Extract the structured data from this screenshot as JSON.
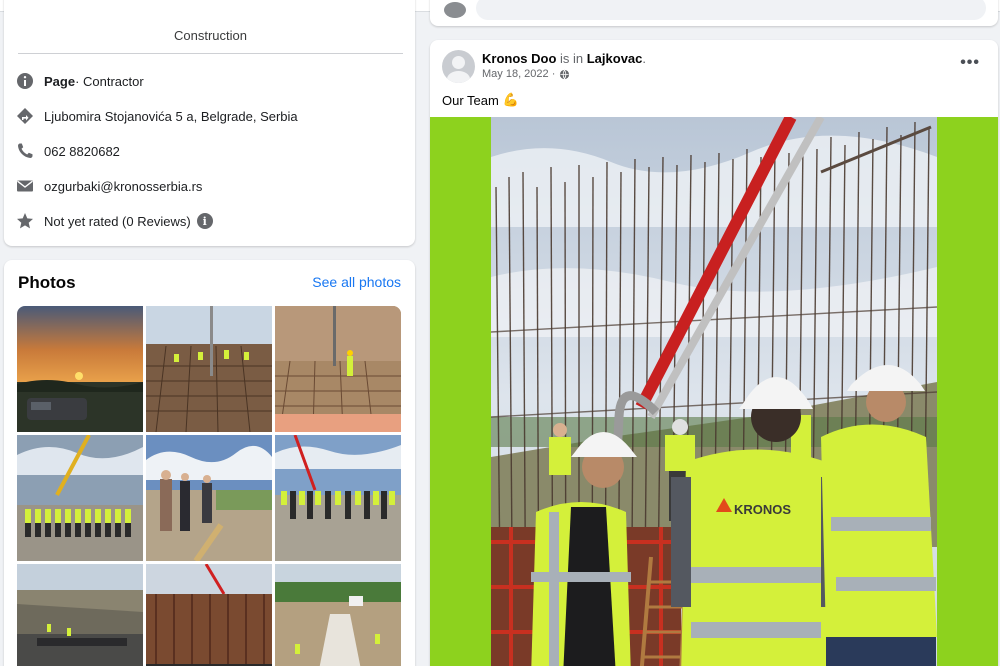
{
  "intro": {
    "category": "Construction",
    "rows": [
      {
        "icon": "info-icon",
        "bold": "Page",
        "text": " · Contractor"
      },
      {
        "icon": "location-icon",
        "text": "Ljubomira Stojanovića 5 a, Belgrade, Serbia"
      },
      {
        "icon": "phone-icon",
        "text": "062 8820682"
      },
      {
        "icon": "email-icon",
        "text": "ozgurbaki@kronosserbia.rs"
      },
      {
        "icon": "star-icon",
        "text": "Not yet rated (0 Reviews)"
      }
    ],
    "info_glyph": "i"
  },
  "photos": {
    "title": "Photos",
    "see_all": "See all photos",
    "thumbnails": [
      "sunset-photo",
      "rebar-deck-workers-photo",
      "rebar-pit-photo",
      "crane-team-photo",
      "site-visit-photo",
      "pump-team-photo",
      "excavation-photo",
      "formwork-wall-photo",
      "trench-photo"
    ]
  },
  "post": {
    "author": "Kronos Doo",
    "is_in": " is in ",
    "location": "Lajkovac",
    "period": ".",
    "date": "May 18, 2022 ·",
    "text": "Our Team",
    "emoji": "💪",
    "more": "•••",
    "vest_logo": "KRONOS"
  },
  "colors": {
    "accent": "#1877f2",
    "media_background": "#8dd21e",
    "hi_vis": "#d4f03a"
  }
}
